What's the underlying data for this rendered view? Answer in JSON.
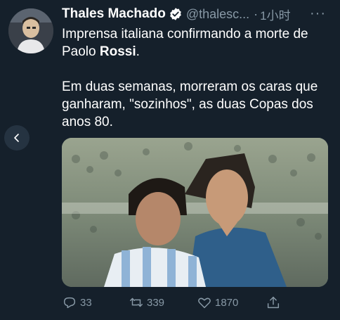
{
  "author": {
    "display_name": "Thales Machado",
    "handle": "@thalesc...",
    "separator": "·",
    "time": "1小时",
    "more_label": "···"
  },
  "tweet": {
    "line1": "Imprensa italiana confirmando a morte de",
    "line2_prefix": "Paolo ",
    "line2_bold": "Rossi",
    "line2_suffix": ".",
    "para2_line1": "Em duas semanas, morreram os caras que",
    "para2_line2": "ganharam, \"sozinhos\", as duas Copas dos",
    "para2_line3": "anos 80."
  },
  "actions": {
    "reply_count": "33",
    "retweet_count": "339",
    "like_count": "1870"
  },
  "icons": {
    "verified": "verified-badge-icon",
    "back": "chevron-left-icon",
    "reply": "reply-icon",
    "retweet": "retweet-icon",
    "like": "heart-icon",
    "share": "share-icon"
  },
  "colors": {
    "background": "#15202b",
    "secondary_text": "#8899a6",
    "verified": "#ffffff"
  }
}
